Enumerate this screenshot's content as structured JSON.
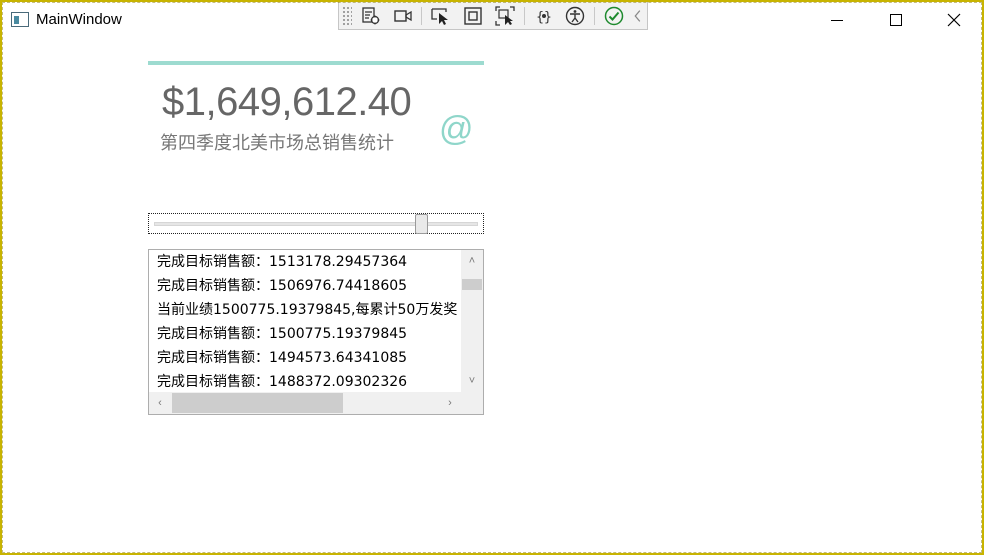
{
  "window": {
    "title": "MainWindow",
    "border_color": "#c8b400"
  },
  "debug_toolbar": {
    "items": [
      "live-visual-tree-icon",
      "record-icon",
      "select-element-icon",
      "display-layout-adorners-icon",
      "track-focused-element-icon",
      "binding-failures-icon",
      "accessibility-checker-icon",
      "check-icon",
      "collapse-chevron-icon"
    ]
  },
  "card": {
    "amount": "$1,649,612.40",
    "subtitle": "第四季度北美市场总销售统计",
    "icon": "@",
    "accent_color": "#9ddbd0"
  },
  "slider": {
    "value_fraction": 0.83
  },
  "list": {
    "items": [
      "完成目标销售额：1513178.29457364",
      "完成目标销售额：1506976.74418605",
      "当前业绩1500775.19379845,每累计50万发奖",
      "完成目标销售额：1500775.19379845",
      "完成目标销售额：1494573.64341085",
      "完成目标销售额：1488372.09302326"
    ]
  }
}
